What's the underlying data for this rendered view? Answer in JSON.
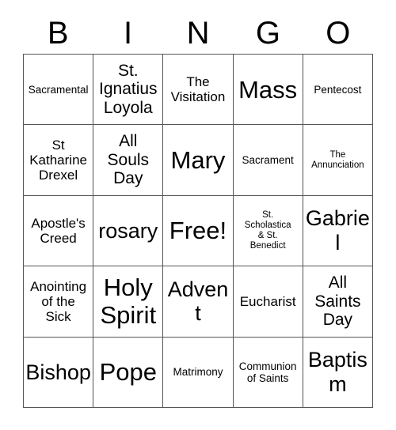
{
  "header": {
    "letters": [
      "B",
      "I",
      "N",
      "G",
      "O"
    ]
  },
  "grid": {
    "rows": [
      [
        {
          "text": "Sacramental",
          "size": "sm"
        },
        {
          "text": "St.\nIgnatius\nLoyola",
          "size": "lg"
        },
        {
          "text": "The\nVisitation",
          "size": "md"
        },
        {
          "text": "Mass",
          "size": "xxl"
        },
        {
          "text": "Pentecost",
          "size": "sm"
        }
      ],
      [
        {
          "text": "St\nKatharine\nDrexel",
          "size": "md"
        },
        {
          "text": "All\nSouls\nDay",
          "size": "lg"
        },
        {
          "text": "Mary",
          "size": "xxl"
        },
        {
          "text": "Sacrament",
          "size": "sm"
        },
        {
          "text": "The\nAnnunciation",
          "size": "xs"
        }
      ],
      [
        {
          "text": "Apostle's\nCreed",
          "size": "md"
        },
        {
          "text": "rosary",
          "size": "xl"
        },
        {
          "text": "Free!",
          "size": "xxl"
        },
        {
          "text": "St.\nScholastica\n& St.\nBenedict",
          "size": "xs"
        },
        {
          "text": "Gabriel",
          "size": "xl"
        }
      ],
      [
        {
          "text": "Anointing\nof the\nSick",
          "size": "md"
        },
        {
          "text": "Holy\nSpirit",
          "size": "xxl"
        },
        {
          "text": "Advent",
          "size": "xl"
        },
        {
          "text": "Eucharist",
          "size": "md"
        },
        {
          "text": "All\nSaints\nDay",
          "size": "lg"
        }
      ],
      [
        {
          "text": "Bishop",
          "size": "xl"
        },
        {
          "text": "Pope",
          "size": "xxl"
        },
        {
          "text": "Matrimony",
          "size": "sm"
        },
        {
          "text": "Communion\nof Saints",
          "size": "sm"
        },
        {
          "text": "Baptism",
          "size": "xl"
        }
      ]
    ]
  },
  "colors": {
    "background": "#ffffff",
    "text": "#000000",
    "border": "#555555"
  }
}
